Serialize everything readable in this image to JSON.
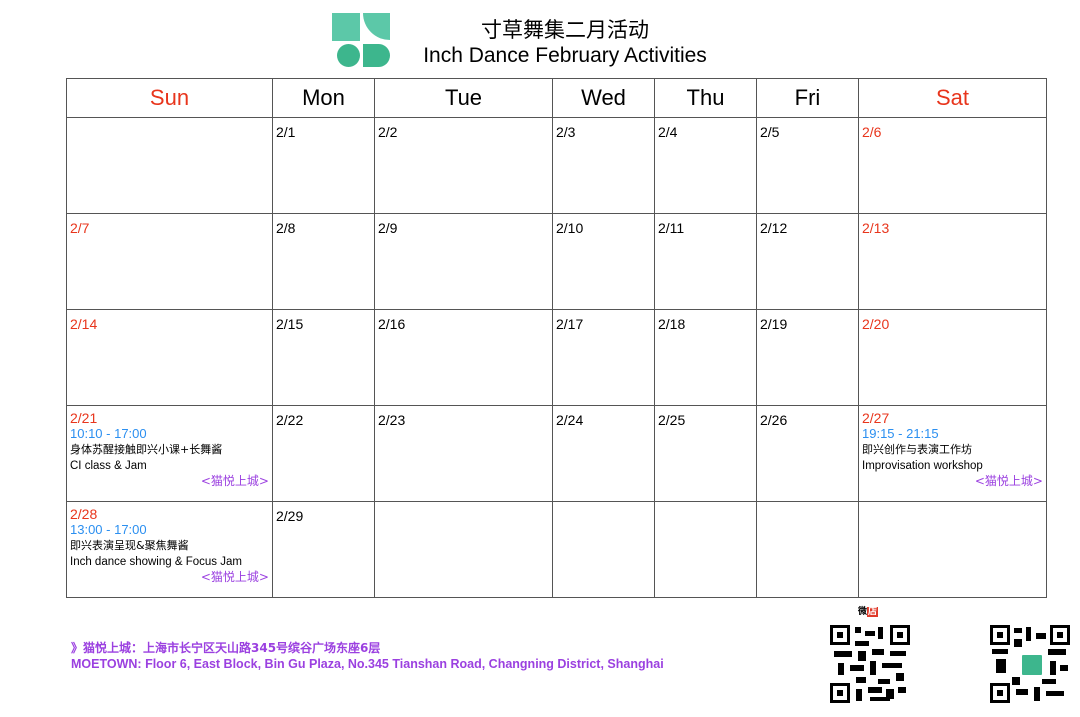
{
  "header": {
    "title_cn": "寸草舞集二月活动",
    "title_en": "Inch Dance February Activities"
  },
  "days": [
    "Sun",
    "Mon",
    "Tue",
    "Wed",
    "Thu",
    "Fri",
    "Sat"
  ],
  "weeks": [
    [
      "",
      "2/1",
      "2/2",
      "2/3",
      "2/4",
      "2/5",
      "2/6"
    ],
    [
      "2/7",
      "2/8",
      "2/9",
      "2/10",
      "2/11",
      "2/12",
      "2/13"
    ],
    [
      "2/14",
      "2/15",
      "2/16",
      "2/17",
      "2/18",
      "2/19",
      "2/20"
    ],
    [
      "2/21",
      "2/22",
      "2/23",
      "2/24",
      "2/25",
      "2/26",
      "2/27"
    ],
    [
      "2/28",
      "2/29",
      "",
      "",
      "",
      "",
      ""
    ]
  ],
  "events": {
    "e0221": {
      "time": "10:10 - 17:00",
      "cn": "身体苏醒接触即兴小课+长舞酱",
      "en": "CI class & Jam",
      "venue": "<猫悦上城>"
    },
    "e0227": {
      "time": "19:15 - 21:15",
      "cn": "即兴创作与表演工作坊",
      "en": "Improvisation workshop",
      "venue": "<猫悦上城>"
    },
    "e0228": {
      "time": "13:00 - 17:00",
      "cn": "即兴表演呈现&聚焦舞酱",
      "en": "Inch dance showing & Focus Jam",
      "venue": "<猫悦上城>"
    }
  },
  "footer": {
    "address_cn": "》猫悦上城：上海市长宁区天山路345号缤谷广场东座6层",
    "address_en": "MOETOWN: Floor 6, East Block, Bin Gu Plaza, No.345 Tianshan Road, Changning District, Shanghai",
    "shop_label_a": "微",
    "shop_label_b": "店"
  },
  "colors": {
    "weekend": "#e8351c",
    "time": "#2b8ff0",
    "venue": "#9b40e0",
    "brand": "#3db68d"
  },
  "icons": {
    "logo": "inch-dance-logo-icon",
    "qr1": "weidian-qr-code-icon",
    "qr2": "brand-qr-code-icon"
  }
}
